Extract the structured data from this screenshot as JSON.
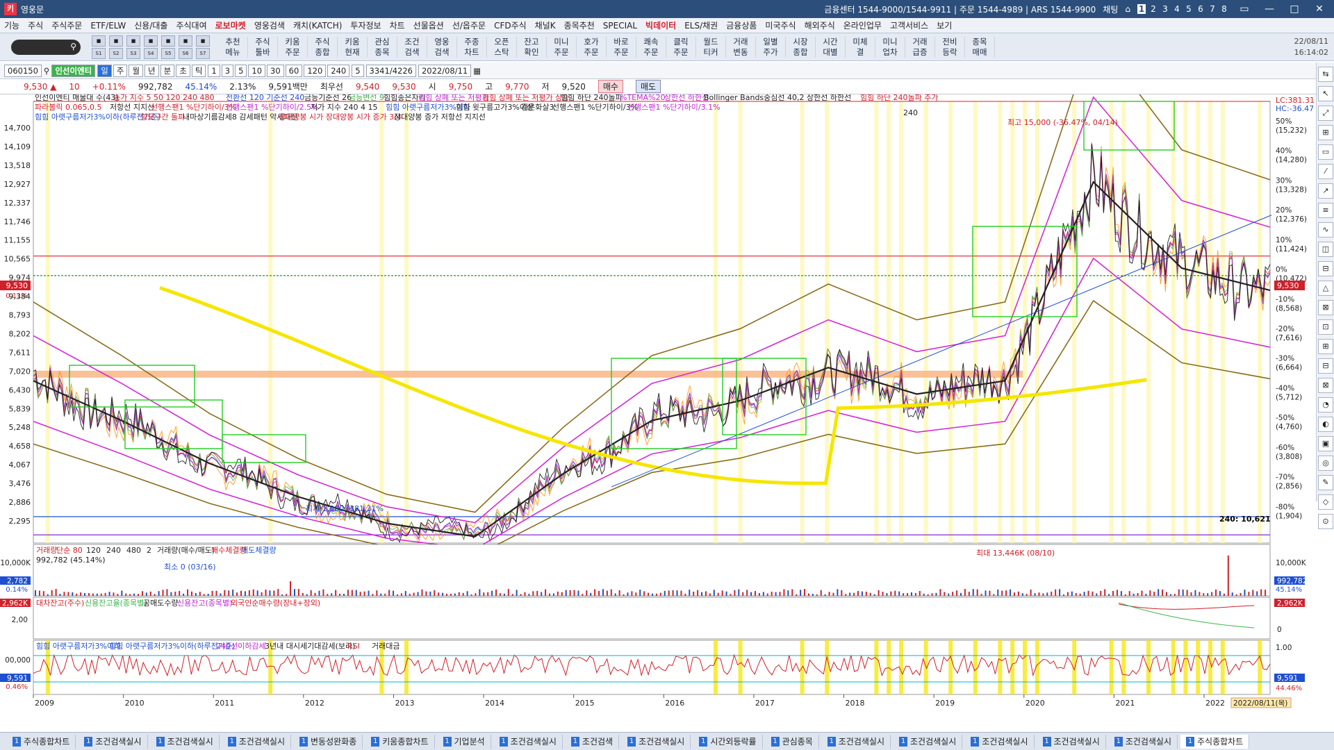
{
  "titlebar": {
    "title": "영웅문",
    "logo": "키",
    "contacts": "금융센터 1544-9000/1544-9911 | 주문 1544-4989 | ARS 1544-9900",
    "chat": "채팅",
    "pages": [
      "1",
      "2",
      "3",
      "4",
      "5",
      "6",
      "7",
      "8"
    ]
  },
  "menubar": {
    "items": [
      "기능",
      "주식",
      "주식주문",
      "ETF/ELW",
      "신용/대출",
      "주식대여",
      "로보마켓",
      "영웅검색",
      "캐치(KATCH)",
      "투자정보",
      "차트",
      "선물옵션",
      "선/옵주문",
      "CFD주식",
      "채널K",
      "종목추천",
      "SPECIAL",
      "빅데이터",
      "ELS/채권",
      "금융상품",
      "미국주식",
      "해외주식",
      "온라인업무",
      "고객서비스",
      "보기"
    ]
  },
  "toolbar": {
    "icon_labels": [
      "S1",
      "S2",
      "S3",
      "S4",
      "S5",
      "S6",
      "S7"
    ],
    "buttons": [
      [
        "추천",
        "메뉴"
      ],
      [
        "주식",
        "툴바"
      ],
      [
        "키움",
        "주문"
      ],
      [
        "주식",
        "종합"
      ],
      [
        "키움",
        "현재"
      ],
      [
        "관심",
        "종목"
      ],
      [
        "조건",
        "검색"
      ],
      [
        "영웅",
        "검색"
      ],
      [
        "주종",
        "차트"
      ],
      [
        "오픈",
        "스탁"
      ],
      [
        "잔고",
        "확인"
      ],
      [
        "미니",
        "주문"
      ],
      [
        "호가",
        "주문"
      ],
      [
        "바로",
        "주문"
      ],
      [
        "쾌속",
        "주문"
      ],
      [
        "클릭",
        "주문"
      ],
      [
        "월드",
        "티커"
      ],
      [
        "거래",
        "변동"
      ],
      [
        "일별",
        "주가"
      ],
      [
        "시장",
        "종합"
      ],
      [
        "시간",
        "대별"
      ],
      [
        "미체",
        "결"
      ],
      [
        "미니",
        "업차"
      ],
      [
        "거래",
        "급증"
      ],
      [
        "전비",
        "등락"
      ],
      [
        "종목",
        "매매"
      ]
    ],
    "date": "22/08/11",
    "time": "16:14:02"
  },
  "chart_toolbar": {
    "code": "060150",
    "name": "인선이엔티",
    "periods": [
      "일",
      "주",
      "월",
      "년",
      "분",
      "초",
      "틱"
    ],
    "intervals": [
      "1",
      "3",
      "5",
      "10",
      "30",
      "60",
      "120",
      "240"
    ],
    "interval_value": "5",
    "count": "3341/4226",
    "date": "2022/08/11"
  },
  "quote": {
    "price": "9,530",
    "change": "10",
    "change_pct": "+0.11%",
    "volume": "992,782",
    "vol_ratio": "45.14%",
    "turnover": "2.13%",
    "amount": "9,591백만",
    "best_sell_label": "최우선",
    "best_sell": "9,540",
    "best_buy": "9,530",
    "open_label": "시",
    "open": "9,750",
    "high_label": "고",
    "high": "9,770",
    "low_label": "저",
    "low": "9,520",
    "buy_btn": "매수",
    "sell_btn": "매도"
  },
  "legend": {
    "row1": [
      {
        "t": "인선이엔티 매물대 수(43)",
        "c": "#222222"
      },
      {
        "t": "종가 지수 5 50 120 240 480",
        "c": "#d0202a"
      },
      {
        "t": "전환선 120 기준선 240",
        "c": "#1e4fd2"
      },
      {
        "t": "금등기준선 26",
        "c": "#222222"
      },
      {
        "t": "금등변선 9",
        "c": "#3bb34a"
      },
      {
        "t": "힘힘종은자리",
        "c": "#222222"
      },
      {
        "t": "힘힘 상폐 또는 저평가",
        "c": "#c026d3"
      },
      {
        "t": "힘힘 상폐 또는 저평가 상승",
        "c": "#d0202a"
      },
      {
        "t": "힘힘 하단 240돌파",
        "c": "#222222"
      },
      {
        "t": "%TEMA%20",
        "c": "#c026d3"
      },
      {
        "t": "상한선 하한선",
        "c": "#c026d3"
      },
      {
        "t": "Bollinger Bands중심선 40,2 상한선 하한선",
        "c": "#222222"
      },
      {
        "t": "힘힘 하단 240돌파 추가",
        "c": "#d0202a"
      }
    ],
    "row2": [
      {
        "t": "파라볼릭 0.065,0.5",
        "c": "#d0202a"
      },
      {
        "t": "저항선 지지선",
        "c": "#222222"
      },
      {
        "t": "선행스팬1 %단기하이/3%",
        "c": "#d0202a"
      },
      {
        "t": "선행스팬1 %단기하이/2.5%",
        "c": "#c026d3"
      },
      {
        "t": "저가 지수 240 4 15",
        "c": "#222222"
      },
      {
        "t": "힘힘 아랫구름저가3%이하",
        "c": "#1e4fd2"
      },
      {
        "t": "힘힘 윗구름고가3%이상",
        "c": "#222222"
      },
      {
        "t": "검은화살3",
        "c": "#222222"
      },
      {
        "t": "선행스팬1 %단기하이/3%",
        "c": "#222222"
      },
      {
        "t": "선행스팬1 %단기하이/3.1%",
        "c": "#c026d3"
      }
    ],
    "row3": [
      {
        "t": "힘힘 아랫구름저가3%이하(하루전기준)",
        "c": "#1e4fd2"
      },
      {
        "t": "힘모구간 돌파",
        "c": "#d0202a"
      },
      {
        "t": "내마상기름감세8 감세패턴 악세패턴",
        "c": "#222222"
      },
      {
        "t": "장대양봉 시가 장대양봉 시가 증가 3/4",
        "c": "#d0202a"
      },
      {
        "t": "장대양봉 증가 저항선 지지선",
        "c": "#222222"
      }
    ]
  },
  "price_axis": {
    "left_ticks": [
      "14,700",
      "14,109",
      "13,518",
      "12,927",
      "12,337",
      "11,746",
      "11,155",
      "10,565",
      "9,974",
      "9,384",
      "8,793",
      "8,202",
      "7,611",
      "7,020",
      "6,430",
      "5,839",
      "5,248",
      "4,658",
      "4,067",
      "3,476",
      "2,886",
      "2,295"
    ],
    "right_ticks": [
      {
        "p": "50%",
        "v": "(15,232)"
      },
      {
        "p": "40%",
        "v": "(14,280)"
      },
      {
        "p": "30%",
        "v": "(13,328)"
      },
      {
        "p": "20%",
        "v": "(12,376)"
      },
      {
        "p": "10%",
        "v": "(11,424)"
      },
      {
        "p": "0%",
        "v": "(10,472)"
      },
      {
        "p": "-10%",
        "v": "(8,568)"
      },
      {
        "p": "-20%",
        "v": "(7,616)"
      },
      {
        "p": "-30%",
        "v": "(6,664)"
      },
      {
        "p": "-40%",
        "v": "(5,712)"
      },
      {
        "p": "-50%",
        "v": "(4,760)"
      },
      {
        "p": "-60%",
        "v": "(3,808)"
      },
      {
        "p": "-70%",
        "v": "(2,856)"
      },
      {
        "p": "-80%",
        "v": "(1,904)"
      }
    ],
    "current_label": "9,530",
    "current_pct": "0.11%",
    "lc_label": "LC:381.31",
    "hc_label": "HC:-36.47"
  },
  "annotations": {
    "high": "최고 15,000 (-36.47%, 04/14)",
    "low": "최저 1,980 (381.31%",
    "max_volume": "최대 13,446K (08/10)",
    "min_volume": "최소 0 (03/16)",
    "label_240": "240: 10,621",
    "bottom_240": "240"
  },
  "volume_panel": {
    "legend": [
      "거래량",
      "단순 80",
      "120",
      "240",
      "480",
      "2",
      "거래량(매수/매도)",
      "매수체결량",
      "매도체결량"
    ],
    "value": "992,782 (45.14%)",
    "left_tick": "10,000K",
    "left_current": "2,782",
    "left_pct": "0.14%",
    "right_tick": "10,000K",
    "right_current": "992,782",
    "right_pct": "45.14%"
  },
  "credit_panel": {
    "legend": [
      "대차잔고(주수)",
      "신용잔고율(종목별)",
      "공매도수량",
      "신용잔고(종목별)",
      "외국인순매수량(장내+장외)"
    ],
    "left_current": "2,962K",
    "left_tick": "2,00",
    "right_current": "2,962K",
    "right_zero": "0"
  },
  "indicator_panel": {
    "legend": [
      "힘힘 아랫구름저가3%이하",
      "힘힘 아랫구름저가3%이하(하루전기준)",
      "240선이하감세",
      "3년내 대시세기대감세(보라)",
      "RSI",
      "거래대금"
    ],
    "left_tick": "00,000",
    "left_current": "9,591",
    "left_pct": "0.46%",
    "right_tick": "1.00",
    "right_current": "9,591",
    "right_pct": "44.46%"
  },
  "x_axis": {
    "years": [
      "2009",
      "2010",
      "2011",
      "2012",
      "2013",
      "2014",
      "2015",
      "2016",
      "2017",
      "2018",
      "2019",
      "2020",
      "2021",
      "2022"
    ],
    "current_date": "2022/08/11(목)"
  },
  "taskbar": {
    "tabs": [
      "주식종합차트",
      "조건검색실시",
      "조건검색실시",
      "조건검색실시",
      "변동성완화종",
      "키움종합차트",
      "기업분석",
      "조건검색실시",
      "조건검색",
      "조건검색실시",
      "시간외등락률",
      "관심종목",
      "조건검색실시",
      "조건검색실시",
      "조건검색실시",
      "조건검색실시",
      "조건검색실시",
      "주식종합차트"
    ]
  },
  "colors": {
    "up": "#d0202a",
    "down": "#1e4fd2",
    "ma_yellow": "#f5e600",
    "band_green": "#22cc22",
    "band_orange": "#f7b27a",
    "magenta": "#d42ad4",
    "olive": "#8a6d1a"
  },
  "chart_data": {
    "type": "line",
    "title": "인선이엔티",
    "x": [
      "2009",
      "2010",
      "2011",
      "2012",
      "2013",
      "2014",
      "2015",
      "2016",
      "2017",
      "2018",
      "2019",
      "2020",
      "2021",
      "2022",
      "2022/08"
    ],
    "series": [
      {
        "name": "",
        "values": [
          6800,
          5600,
          4300,
          3300,
          2500,
          2100,
          4000,
          5600,
          6200,
          7200,
          6400,
          6800,
          12800,
          10200,
          9530
        ]
      }
    ],
    "ylim": [
      1904,
      15232
    ],
    "annotations": [
      "최고 15,000 (-36.47%, 04/14)",
      "최저 1,980 (381.31%"
    ]
  }
}
